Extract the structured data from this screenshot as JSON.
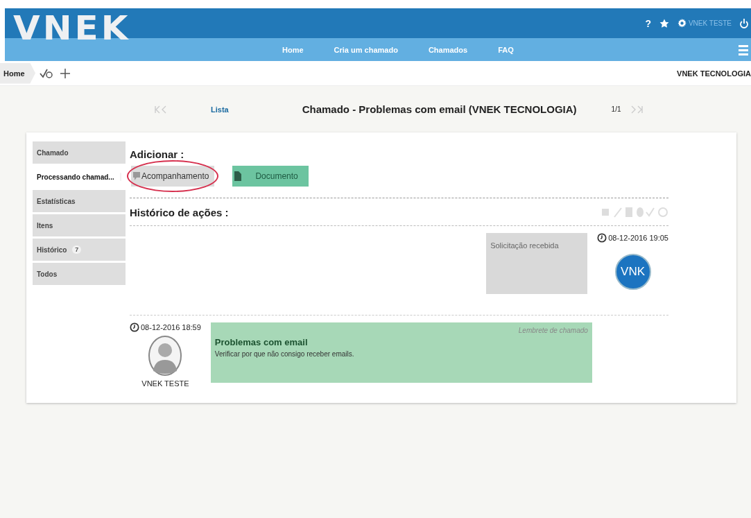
{
  "header": {
    "logo": "VNEK",
    "help": "?",
    "user": "VNEK TESTE"
  },
  "nav": [
    {
      "label": "Home",
      "selected": false
    },
    {
      "label": "Cria um chamado",
      "selected": false
    },
    {
      "label": "Chamados",
      "selected": false
    },
    {
      "label": "FAQ",
      "selected": false
    }
  ],
  "breadcrumb": {
    "home": "Home",
    "entity": "VNEK TECNOLOGIA"
  },
  "pager": {
    "list_link": "Lista",
    "title": "Chamado - Problemas com email (VNEK TECNOLOGIA)",
    "count": "1/1"
  },
  "sidebar": [
    {
      "label": "Chamado",
      "selected": false
    },
    {
      "label": "Processando chamad...",
      "selected": true,
      "badge": true
    },
    {
      "label": "Estatísticas",
      "selected": false
    },
    {
      "label": "Itens",
      "selected": false
    },
    {
      "label": "Histórico",
      "selected": false,
      "count": "7"
    },
    {
      "label": "Todos",
      "selected": false
    }
  ],
  "add": {
    "label": "Adicionar :",
    "buttons": [
      {
        "label": "Acompanhamento",
        "kind": "followup",
        "highlighted": true
      },
      {
        "label": "Documento",
        "kind": "document",
        "highlighted": false
      }
    ]
  },
  "history": {
    "label": "Histórico de ações :",
    "entries": [
      {
        "kind": "system",
        "text": "Solicitação recebida",
        "time": "08-12-2016 19:05",
        "avatar_text": "VNK"
      },
      {
        "kind": "reminder",
        "time": "08-12-2016 18:59",
        "author": "VNEK TESTE",
        "tag": "Lembrete de chamado",
        "title": "Problemas com email",
        "body": "Verificar por que não consigo receber emails."
      }
    ]
  }
}
